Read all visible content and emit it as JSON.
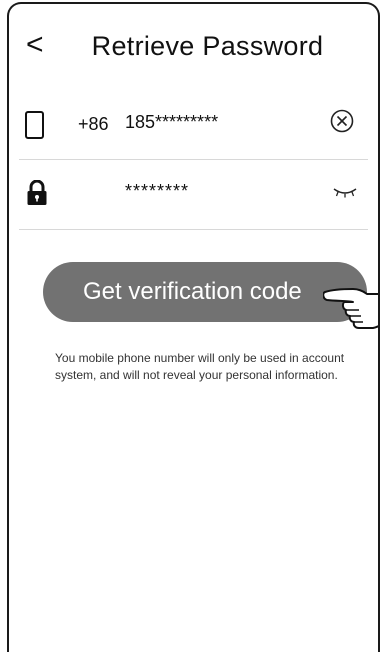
{
  "header": {
    "back_label": "<",
    "title": "Retrieve Password"
  },
  "phone_row": {
    "icon": "phone-icon",
    "country_code": "+86",
    "phone_value": "185*********",
    "clear_icon": "clear-circle-x-icon"
  },
  "password_row": {
    "icon": "lock-icon",
    "password_value": "********",
    "toggle_icon": "eye-closed-icon"
  },
  "verify_button": {
    "label": "Get verification code",
    "color": "#727272",
    "pointer_icon": "tap-hand-icon"
  },
  "notice": {
    "text": "You mobile phone number will only be used in account system, and will not reveal your personal information."
  }
}
